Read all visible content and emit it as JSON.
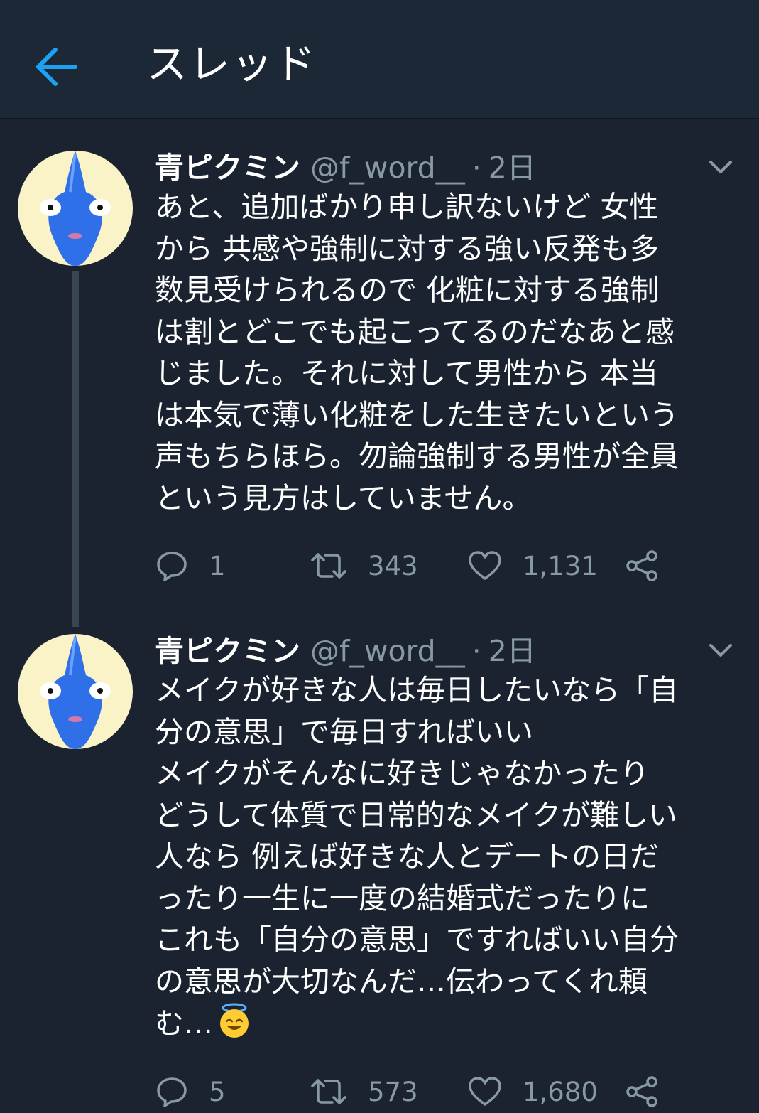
{
  "header": {
    "title": "スレッド",
    "back_icon": "arrow-left-icon",
    "accent": "#1da1f2"
  },
  "tweets": [
    {
      "name": "青ピクミン",
      "handle": "@f_word__",
      "separator": "·",
      "time": "2日",
      "lines": [
        "あと、追加ばかり申し訳ないけど 女性",
        "から 共感や強制に対する強い反発も多",
        "数見受けられるので 化粧に対する強制",
        "は割とどこでも起こってるのだなあと感",
        "じました。それに対して男性から 本当",
        "は本気で薄い化粧をした生きたいという",
        "声もちらほら。勿論強制する男性が全員",
        "という見方はしていません。"
      ],
      "replies": "1",
      "retweets": "343",
      "likes": "1,131"
    },
    {
      "name": "青ピクミン",
      "handle": "@f_word__",
      "separator": "·",
      "time": "2日",
      "lines": [
        "メイクが好きな人は毎日したいなら「自",
        "分の意思」で毎日すればいい",
        "メイクがそんなに好きじゃなかったり",
        "どうして体質で日常的なメイクが難しい",
        "人なら 例えば好きな人とデートの日だ",
        "ったり一生に一度の結婚式だったりに",
        "これも「自分の意思」ですればいい自分",
        "の意思が大切なんだ…伝わってくれ頼",
        "む…"
      ],
      "emoji": "smiling-face-with-halo-icon",
      "replies": "5",
      "retweets": "573",
      "likes": "1,680"
    }
  ],
  "colors": {
    "background": "#1b2330",
    "topbar": "#1c2836",
    "secondary_text": "#8899a6",
    "avatar_bg": "#fbf3c8",
    "pikmin_blue": "#2f6fe8"
  }
}
